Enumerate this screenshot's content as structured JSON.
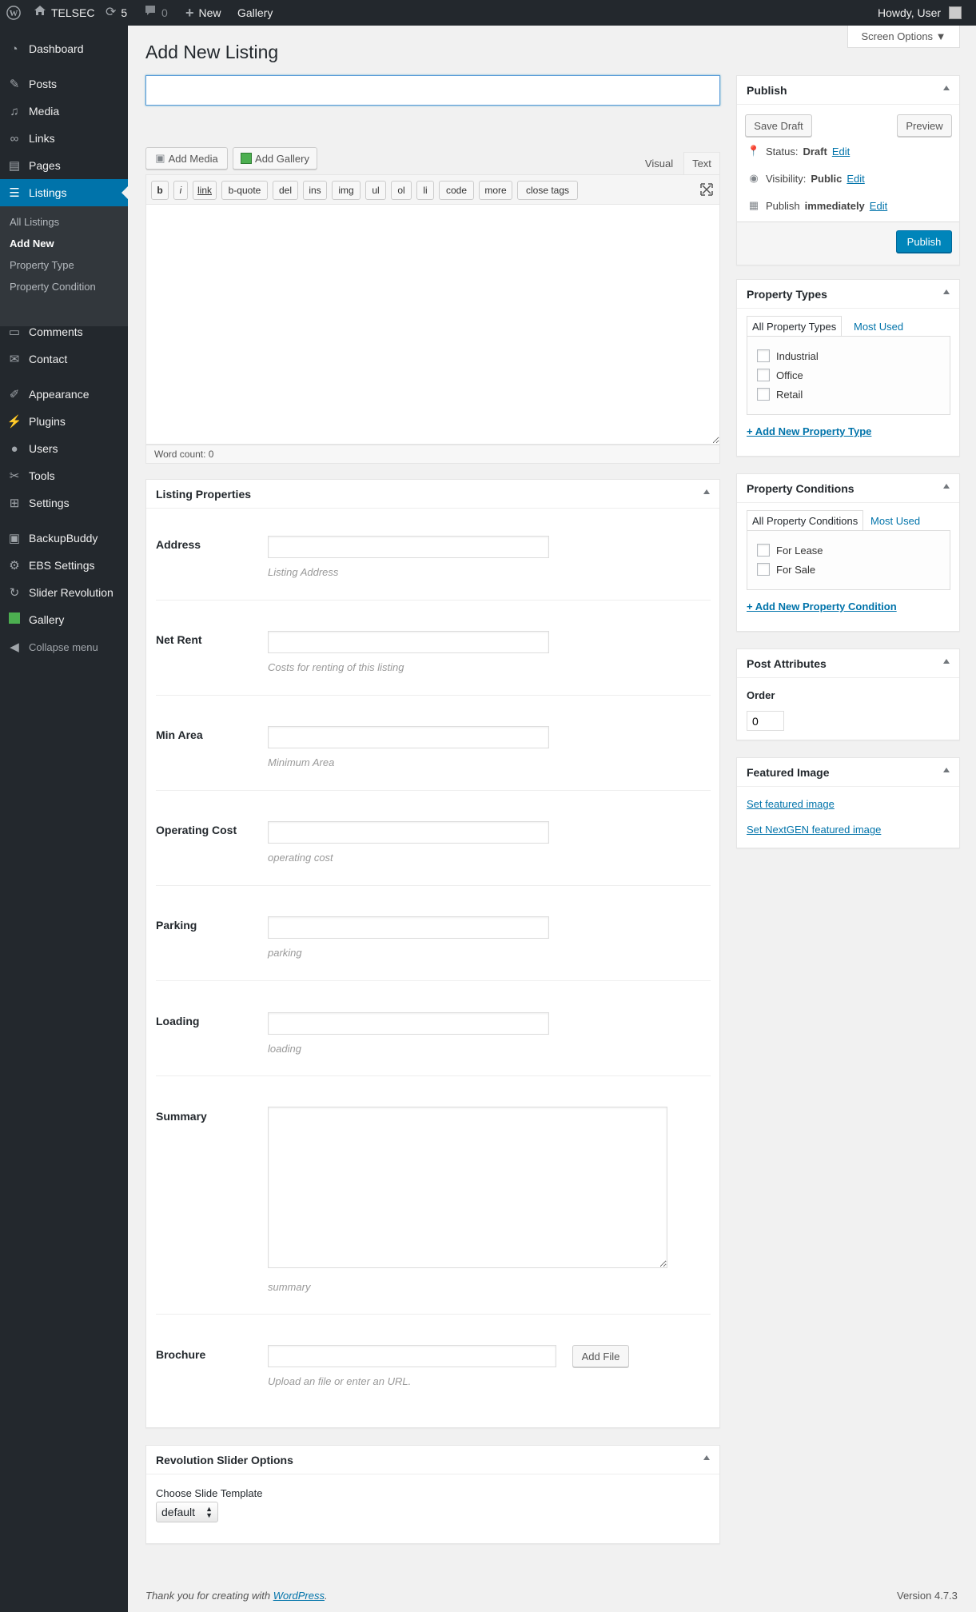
{
  "adminbar": {
    "site_name": "TELSEC",
    "updates_count": "5",
    "comments_count": "0",
    "new_label": "New",
    "gallery_label": "Gallery",
    "howdy": "Howdy, User"
  },
  "sidebar": {
    "items": [
      {
        "label": "Dashboard",
        "icon": "dashboard-icon"
      },
      {
        "label": "Posts",
        "icon": "pin-icon"
      },
      {
        "label": "Media",
        "icon": "media-icon"
      },
      {
        "label": "Links",
        "icon": "link-icon"
      },
      {
        "label": "Pages",
        "icon": "page-icon"
      },
      {
        "label": "Listings",
        "icon": "list-icon"
      },
      {
        "label": "Comments",
        "icon": "comment-icon"
      },
      {
        "label": "Contact",
        "icon": "mail-icon"
      },
      {
        "label": "Appearance",
        "icon": "brush-icon"
      },
      {
        "label": "Plugins",
        "icon": "plugin-icon"
      },
      {
        "label": "Users",
        "icon": "user-icon"
      },
      {
        "label": "Tools",
        "icon": "wrench-icon"
      },
      {
        "label": "Settings",
        "icon": "settings-icon"
      },
      {
        "label": "BackupBuddy",
        "icon": "backup-icon"
      },
      {
        "label": "EBS Settings",
        "icon": "gear-icon"
      },
      {
        "label": "Slider Revolution",
        "icon": "refresh-icon"
      },
      {
        "label": "Gallery",
        "icon": "gallery-icon"
      },
      {
        "label": "Collapse menu",
        "icon": "collapse-icon"
      }
    ],
    "submenu": [
      "All Listings",
      "Add New",
      "Property Type",
      "Property Condition"
    ]
  },
  "header": {
    "title": "Add New Listing",
    "screen_options": "Screen Options ▼"
  },
  "editor": {
    "add_media": "Add Media",
    "add_gallery": "Add Gallery",
    "tab_visual": "Visual",
    "tab_text": "Text",
    "quicktags": [
      "b",
      "i",
      "link",
      "b-quote",
      "del",
      "ins",
      "img",
      "ul",
      "ol",
      "li",
      "code",
      "more",
      "close tags"
    ],
    "word_count": "Word count: 0"
  },
  "listing_properties": {
    "title": "Listing Properties",
    "fields": [
      {
        "label": "Address",
        "desc": "Listing Address"
      },
      {
        "label": "Net Rent",
        "desc": "Costs for renting of this listing"
      },
      {
        "label": "Min Area",
        "desc": "Minimum Area"
      },
      {
        "label": "Operating Cost",
        "desc": "operating cost"
      },
      {
        "label": "Parking",
        "desc": "parking"
      },
      {
        "label": "Loading",
        "desc": "loading"
      },
      {
        "label": "Summary",
        "desc": "summary"
      },
      {
        "label": "Brochure",
        "desc": "Upload an file or enter an URL."
      }
    ],
    "add_file": "Add File"
  },
  "revslider": {
    "title": "Revolution Slider Options",
    "choose_label": "Choose Slide Template",
    "selected": "default"
  },
  "publish": {
    "title": "Publish",
    "save_draft": "Save Draft",
    "preview": "Preview",
    "status_label": "Status:",
    "status_value": "Draft",
    "visibility_label": "Visibility:",
    "visibility_value": "Public",
    "publish_label": "Publish",
    "publish_value": "immediately",
    "edit": "Edit",
    "publish_button": "Publish"
  },
  "property_types": {
    "title": "Property Types",
    "tab_all": "All Property Types",
    "tab_most": "Most Used",
    "items": [
      "Industrial",
      "Office",
      "Retail"
    ],
    "add_link": "+ Add New Property Type"
  },
  "property_conditions": {
    "title": "Property Conditions",
    "tab_all": "All Property Conditions",
    "tab_most": "Most Used",
    "items": [
      "For Lease",
      "For Sale"
    ],
    "add_link": "+ Add New Property Condition"
  },
  "post_attributes": {
    "title": "Post Attributes",
    "order_label": "Order",
    "order_value": "0"
  },
  "featured_image": {
    "title": "Featured Image",
    "set_link": "Set featured image",
    "set_nextgen_link": "Set NextGEN featured image"
  },
  "footer": {
    "thanks": "Thank you for creating with",
    "wordpress": "WordPress",
    "version": "Version 4.7.3"
  },
  "colors": {
    "admin_dark": "#23282d",
    "accent": "#0073aa",
    "primary_button": "#0085ba"
  }
}
